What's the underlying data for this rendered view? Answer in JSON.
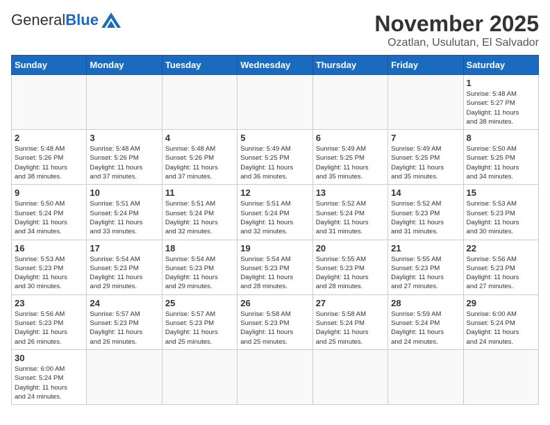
{
  "logo": {
    "general": "General",
    "blue": "Blue"
  },
  "header": {
    "month": "November 2025",
    "location": "Ozatlan, Usulutan, El Salvador"
  },
  "weekdays": [
    "Sunday",
    "Monday",
    "Tuesday",
    "Wednesday",
    "Thursday",
    "Friday",
    "Saturday"
  ],
  "weeks": [
    [
      {
        "day": "",
        "info": ""
      },
      {
        "day": "",
        "info": ""
      },
      {
        "day": "",
        "info": ""
      },
      {
        "day": "",
        "info": ""
      },
      {
        "day": "",
        "info": ""
      },
      {
        "day": "",
        "info": ""
      },
      {
        "day": "1",
        "info": "Sunrise: 5:48 AM\nSunset: 5:27 PM\nDaylight: 11 hours\nand 38 minutes."
      }
    ],
    [
      {
        "day": "2",
        "info": "Sunrise: 5:48 AM\nSunset: 5:26 PM\nDaylight: 11 hours\nand 38 minutes."
      },
      {
        "day": "3",
        "info": "Sunrise: 5:48 AM\nSunset: 5:26 PM\nDaylight: 11 hours\nand 37 minutes."
      },
      {
        "day": "4",
        "info": "Sunrise: 5:48 AM\nSunset: 5:26 PM\nDaylight: 11 hours\nand 37 minutes."
      },
      {
        "day": "5",
        "info": "Sunrise: 5:49 AM\nSunset: 5:25 PM\nDaylight: 11 hours\nand 36 minutes."
      },
      {
        "day": "6",
        "info": "Sunrise: 5:49 AM\nSunset: 5:25 PM\nDaylight: 11 hours\nand 35 minutes."
      },
      {
        "day": "7",
        "info": "Sunrise: 5:49 AM\nSunset: 5:25 PM\nDaylight: 11 hours\nand 35 minutes."
      },
      {
        "day": "8",
        "info": "Sunrise: 5:50 AM\nSunset: 5:25 PM\nDaylight: 11 hours\nand 34 minutes."
      }
    ],
    [
      {
        "day": "9",
        "info": "Sunrise: 5:50 AM\nSunset: 5:24 PM\nDaylight: 11 hours\nand 34 minutes."
      },
      {
        "day": "10",
        "info": "Sunrise: 5:51 AM\nSunset: 5:24 PM\nDaylight: 11 hours\nand 33 minutes."
      },
      {
        "day": "11",
        "info": "Sunrise: 5:51 AM\nSunset: 5:24 PM\nDaylight: 11 hours\nand 32 minutes."
      },
      {
        "day": "12",
        "info": "Sunrise: 5:51 AM\nSunset: 5:24 PM\nDaylight: 11 hours\nand 32 minutes."
      },
      {
        "day": "13",
        "info": "Sunrise: 5:52 AM\nSunset: 5:24 PM\nDaylight: 11 hours\nand 31 minutes."
      },
      {
        "day": "14",
        "info": "Sunrise: 5:52 AM\nSunset: 5:23 PM\nDaylight: 11 hours\nand 31 minutes."
      },
      {
        "day": "15",
        "info": "Sunrise: 5:53 AM\nSunset: 5:23 PM\nDaylight: 11 hours\nand 30 minutes."
      }
    ],
    [
      {
        "day": "16",
        "info": "Sunrise: 5:53 AM\nSunset: 5:23 PM\nDaylight: 11 hours\nand 30 minutes."
      },
      {
        "day": "17",
        "info": "Sunrise: 5:54 AM\nSunset: 5:23 PM\nDaylight: 11 hours\nand 29 minutes."
      },
      {
        "day": "18",
        "info": "Sunrise: 5:54 AM\nSunset: 5:23 PM\nDaylight: 11 hours\nand 29 minutes."
      },
      {
        "day": "19",
        "info": "Sunrise: 5:54 AM\nSunset: 5:23 PM\nDaylight: 11 hours\nand 28 minutes."
      },
      {
        "day": "20",
        "info": "Sunrise: 5:55 AM\nSunset: 5:23 PM\nDaylight: 11 hours\nand 28 minutes."
      },
      {
        "day": "21",
        "info": "Sunrise: 5:55 AM\nSunset: 5:23 PM\nDaylight: 11 hours\nand 27 minutes."
      },
      {
        "day": "22",
        "info": "Sunrise: 5:56 AM\nSunset: 5:23 PM\nDaylight: 11 hours\nand 27 minutes."
      }
    ],
    [
      {
        "day": "23",
        "info": "Sunrise: 5:56 AM\nSunset: 5:23 PM\nDaylight: 11 hours\nand 26 minutes."
      },
      {
        "day": "24",
        "info": "Sunrise: 5:57 AM\nSunset: 5:23 PM\nDaylight: 11 hours\nand 26 minutes."
      },
      {
        "day": "25",
        "info": "Sunrise: 5:57 AM\nSunset: 5:23 PM\nDaylight: 11 hours\nand 25 minutes."
      },
      {
        "day": "26",
        "info": "Sunrise: 5:58 AM\nSunset: 5:23 PM\nDaylight: 11 hours\nand 25 minutes."
      },
      {
        "day": "27",
        "info": "Sunrise: 5:58 AM\nSunset: 5:24 PM\nDaylight: 11 hours\nand 25 minutes."
      },
      {
        "day": "28",
        "info": "Sunrise: 5:59 AM\nSunset: 5:24 PM\nDaylight: 11 hours\nand 24 minutes."
      },
      {
        "day": "29",
        "info": "Sunrise: 6:00 AM\nSunset: 5:24 PM\nDaylight: 11 hours\nand 24 minutes."
      }
    ],
    [
      {
        "day": "30",
        "info": "Sunrise: 6:00 AM\nSunset: 5:24 PM\nDaylight: 11 hours\nand 24 minutes."
      },
      {
        "day": "",
        "info": ""
      },
      {
        "day": "",
        "info": ""
      },
      {
        "day": "",
        "info": ""
      },
      {
        "day": "",
        "info": ""
      },
      {
        "day": "",
        "info": ""
      },
      {
        "day": "",
        "info": ""
      }
    ]
  ]
}
